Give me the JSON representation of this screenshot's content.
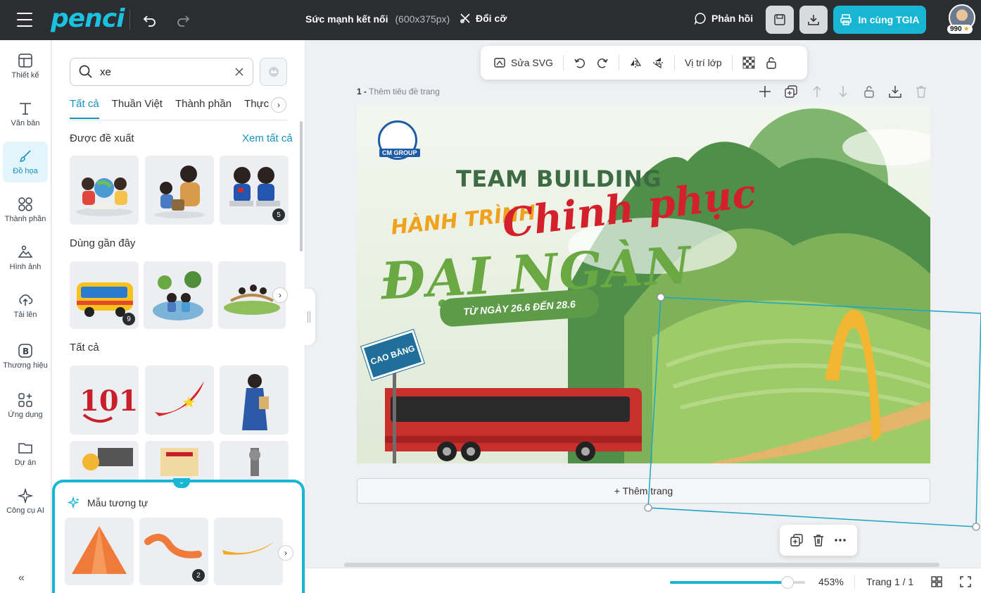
{
  "header": {
    "doc_title": "Sức mạnh kết nối",
    "doc_size": "(600x375px)",
    "resize_label": "Đổi cỡ",
    "feedback_label": "Phản hồi",
    "print_label": "In cùng TGIA",
    "credits": "990"
  },
  "rail": {
    "items": [
      {
        "label": "Thiết kế",
        "icon": "layout-icon"
      },
      {
        "label": "Văn bản",
        "icon": "text-icon"
      },
      {
        "label": "Đồ họa",
        "icon": "brush-icon"
      },
      {
        "label": "Thành phần",
        "icon": "shapes-icon"
      },
      {
        "label": "Hình ảnh",
        "icon": "image-icon"
      },
      {
        "label": "Tải lên",
        "icon": "upload-icon"
      },
      {
        "label": "Thương hiệu",
        "icon": "brand-icon"
      },
      {
        "label": "Ứng dụng",
        "icon": "apps-icon"
      },
      {
        "label": "Dự án",
        "icon": "folder-icon"
      },
      {
        "label": "Công cụ AI",
        "icon": "sparkle-icon"
      }
    ]
  },
  "panel": {
    "search_value": "xe",
    "tabs": [
      "Tất cả",
      "Thuần Việt",
      "Thành phần",
      "Thực ph"
    ],
    "suggested_title": "Được đề xuất",
    "see_all": "Xem tất cả",
    "recent_title": "Dùng gần đây",
    "all_title": "Tất cả",
    "suggested_badge": "5",
    "recent_badge": "9"
  },
  "similar": {
    "title": "Mẫu tương tự",
    "badge": "2"
  },
  "editor": {
    "toolbar": {
      "edit_svg": "Sửa SVG",
      "layer_pos": "Vị trí lớp"
    },
    "page_number": "1 -",
    "page_title_placeholder": "Thêm tiêu đề trang",
    "add_page": "+ Thêm trang",
    "zoom": "453%",
    "zoom_fraction": 0.86,
    "page_indicator": "Trang 1 / 1"
  },
  "design": {
    "logo_text": "CM GROUP",
    "heading": "TEAM BUILDING",
    "line1": "HÀNH TRÌNH",
    "line2": "Chinh phục",
    "line3": "ĐẠI NGÀN",
    "dates": "TỪ NGÀY 26.6 ĐẾN 28.6",
    "sign": "CAO BẰNG"
  },
  "colors": {
    "accent": "#19b6d4",
    "topbar": "#2b2d31",
    "selection": "#1aa6c2"
  }
}
